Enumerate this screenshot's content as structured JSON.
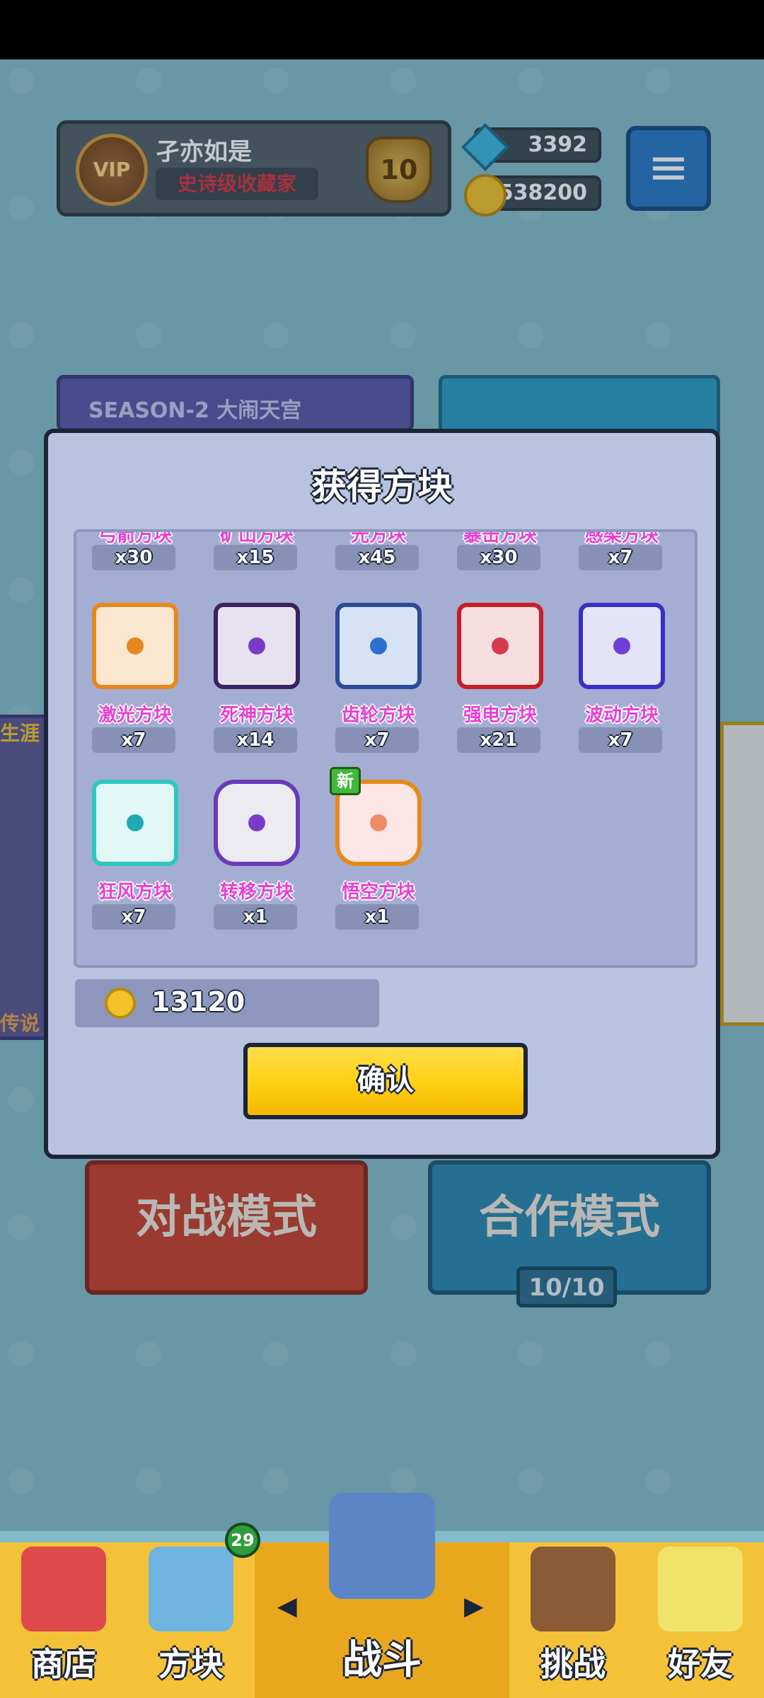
{
  "profile": {
    "vip_label": "VIP",
    "name": "孑亦如是",
    "title": "史诗级收藏家",
    "rank": "10"
  },
  "currency": {
    "gems": "3392",
    "coins": "538200"
  },
  "banners": {
    "season": "SEASON-2 大闹天宫",
    "left_side_label": "生涯",
    "left_side_bottom": "传说"
  },
  "modes": {
    "battle": "对战模式",
    "coop": "合作模式",
    "coop_count": "10/10"
  },
  "modal": {
    "title": "获得方块",
    "top_row": [
      {
        "name": "弓箭方块",
        "count": "x30"
      },
      {
        "name": "矿山方块",
        "count": "x15"
      },
      {
        "name": "光方块",
        "count": "x45"
      },
      {
        "name": "暴击方块",
        "count": "x30"
      },
      {
        "name": "感染方块",
        "count": "x7"
      }
    ],
    "items": [
      {
        "name": "激光方块",
        "count": "x7",
        "border": "#e7871f",
        "fill": "#fbe6cf",
        "pip": "#e7871f"
      },
      {
        "name": "死神方块",
        "count": "x14",
        "border": "#3b2260",
        "fill": "#e6e2f0",
        "pip": "#7a3bc9"
      },
      {
        "name": "齿轮方块",
        "count": "x7",
        "border": "#2a4a9a",
        "fill": "#d7e3f5",
        "pip": "#2f6ed1"
      },
      {
        "name": "强电方块",
        "count": "x21",
        "border": "#c81e28",
        "fill": "#f6dede",
        "pip": "#d63a4d"
      },
      {
        "name": "波动方块",
        "count": "x7",
        "border": "#3a2fc4",
        "fill": "#e3e4f8",
        "pip": "#6f3fd6"
      },
      {
        "name": "狂风方块",
        "count": "x7",
        "border": "#2cc8c0",
        "fill": "#e2f8f6",
        "pip": "#21a9b6"
      },
      {
        "name": "转移方块",
        "count": "x1",
        "border": "#6b3ab7",
        "fill": "#ecebf2",
        "pip": "#7b3bc9"
      },
      {
        "name": "悟空方块",
        "count": "x1",
        "border": "#e58a19",
        "fill": "#fde6e6",
        "pip": "#f08b6a",
        "badge": "新"
      }
    ],
    "total_coins": "13120",
    "confirm_label": "确认"
  },
  "nav": {
    "shop": "商店",
    "dice": "方块",
    "dice_badge": "29",
    "battle": "战斗",
    "challenge": "挑战",
    "friends": "好友"
  }
}
